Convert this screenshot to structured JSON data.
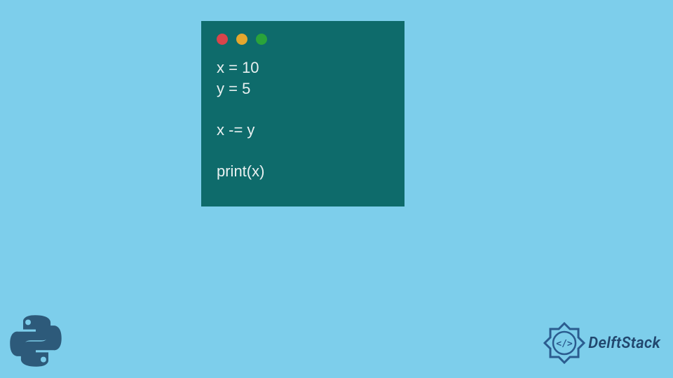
{
  "code": {
    "line1": "x = 10",
    "line2": "y = 5",
    "line3": "",
    "line4": "x -= y",
    "line5": "",
    "line6": "print(x)"
  },
  "branding": {
    "name": "DelftStack"
  },
  "window": {
    "dots": {
      "red": "#d9444b",
      "yellow": "#e5a72e",
      "green": "#2aa33a"
    }
  }
}
